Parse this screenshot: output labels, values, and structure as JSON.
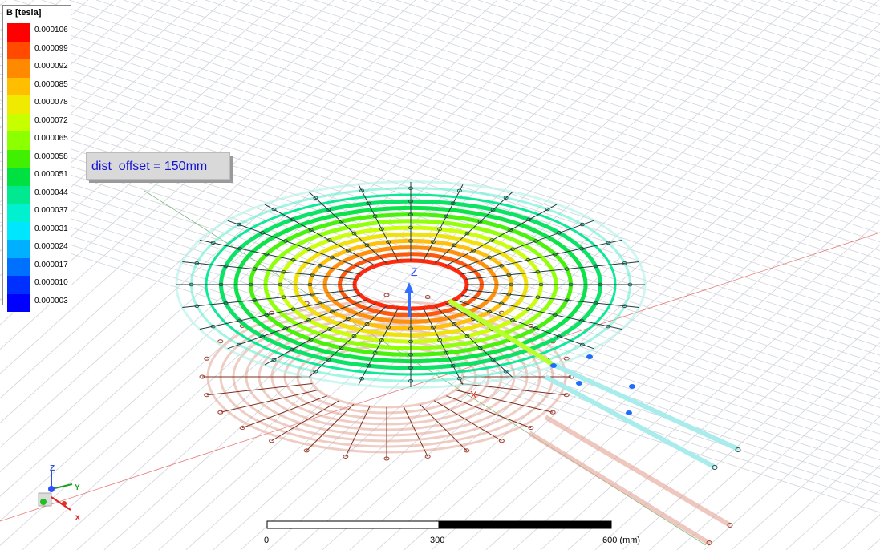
{
  "legend": {
    "title": "B [tesla]",
    "entries": [
      {
        "value": "0.000106",
        "color": "#ff0000"
      },
      {
        "value": "0.000099",
        "color": "#ff4a00"
      },
      {
        "value": "0.000092",
        "color": "#ff8a00"
      },
      {
        "value": "0.000085",
        "color": "#ffbe00"
      },
      {
        "value": "0.000078",
        "color": "#f0ea00"
      },
      {
        "value": "0.000072",
        "color": "#c8ff00"
      },
      {
        "value": "0.000065",
        "color": "#8cff00"
      },
      {
        "value": "0.000058",
        "color": "#40f000"
      },
      {
        "value": "0.000051",
        "color": "#00e040"
      },
      {
        "value": "0.000044",
        "color": "#00e890"
      },
      {
        "value": "0.000037",
        "color": "#00f0d0"
      },
      {
        "value": "0.000031",
        "color": "#00e6ff"
      },
      {
        "value": "0.000024",
        "color": "#00b0ff"
      },
      {
        "value": "0.000017",
        "color": "#0070ff"
      },
      {
        "value": "0.000010",
        "color": "#0030ff"
      },
      {
        "value": "0.000003",
        "color": "#0000ff"
      }
    ]
  },
  "annotation": {
    "text": "dist_offset = 150mm"
  },
  "axes": {
    "z_label": "Z",
    "x_label": "X",
    "triad": {
      "x": "x",
      "y": "Y",
      "z": "Z"
    }
  },
  "scale_bar": {
    "labels": [
      "0",
      "300",
      "600 (mm)"
    ]
  },
  "colors": {
    "grid": "#d0d4dc",
    "lower_coil": "#e2a494",
    "red_axis": "#e04040",
    "green_axis": "#50a050",
    "upper_lines": "#1c3c3c"
  }
}
